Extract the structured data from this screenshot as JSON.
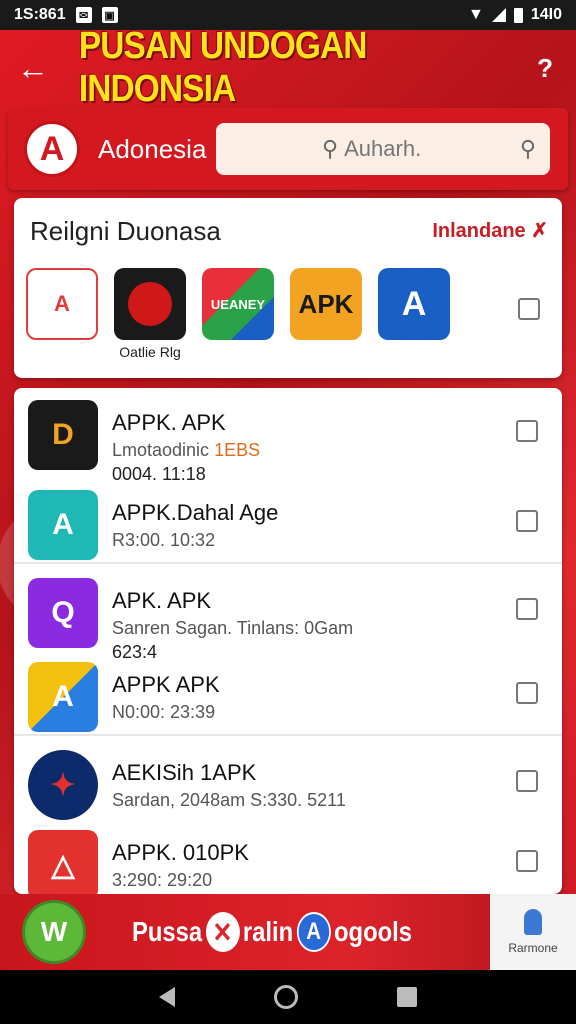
{
  "status": {
    "time": "1S:861",
    "clock": "14I0"
  },
  "header": {
    "title": "PUSAN UNDOGAN INDONSIA",
    "back_icon": "arrow-left-icon",
    "help_icon": "help-icon"
  },
  "search": {
    "region": "Adonesia",
    "placeholder": "Auharh."
  },
  "featured": {
    "title": "Reilgni Duonasa",
    "link": "Inlandane",
    "items": [
      {
        "caption": "",
        "icon": "flag-a-icon",
        "color": "#e23c3c"
      },
      {
        "caption": "Oatlie Rlg",
        "icon": "red-bird-icon",
        "color": "#d01818"
      },
      {
        "caption": "",
        "icon": "map-app-icon",
        "color": "#e8303a",
        "text": "UEANEY"
      },
      {
        "caption": "",
        "icon": "apk-icon",
        "color": "#f2a321",
        "text": "APK"
      },
      {
        "caption": "",
        "icon": "a-blue-icon",
        "color": "#1a5fc4",
        "text": "A"
      }
    ]
  },
  "apps": [
    {
      "name": "APPK. APK",
      "meta": "Lmotaodinic",
      "meta_highlight": "1EBS",
      "meta2": "0004. 11:18",
      "icon": "dl-icon",
      "color": "#1a1a1a",
      "letter": "D"
    },
    {
      "name": "APPK.Dahal Age",
      "meta": "R3:00. 10:32",
      "icon": "a-teal-icon",
      "color": "#1fb8b6",
      "letter": "A"
    },
    {
      "name": "APK. APK",
      "meta": "Sanren Sagan. Tinlans: 0Gam",
      "meta2": "623:4",
      "icon": "magnify-purple-icon",
      "color": "#8a2be2",
      "letter": "Q"
    },
    {
      "name": "APPK APK",
      "meta": "N0:00: 23:39",
      "icon": "a-yellow-icon",
      "color": "#2a7ee0",
      "letter": "A"
    },
    {
      "name": "AEKISih 1APK",
      "meta": "Sardan, 2048am S:330. 5211",
      "icon": "compass-icon",
      "color": "#0d2a6b",
      "letter": "✦"
    },
    {
      "name": "APPK. 010PK",
      "meta": "3:290: 29:20",
      "icon": "triangle-red-icon",
      "color": "#e3322d",
      "letter": "△"
    }
  ],
  "promo": {
    "text_left": "Pussa",
    "text_mid": "ralin",
    "text_right": "ogools",
    "remove_label": "Rarmone"
  }
}
